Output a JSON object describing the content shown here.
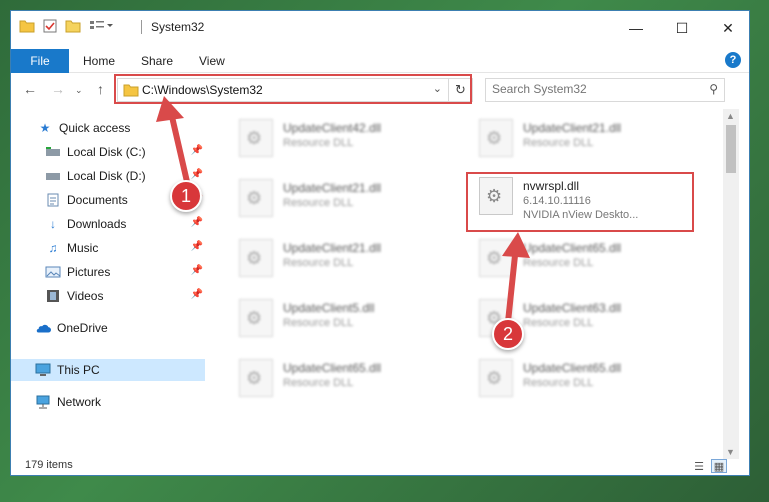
{
  "window": {
    "title": "System32",
    "controls": {
      "minimize": "—",
      "maximize": "☐",
      "close": "✕"
    }
  },
  "ribbon": {
    "tabs": [
      {
        "label": "File"
      },
      {
        "label": "Home"
      },
      {
        "label": "Share"
      },
      {
        "label": "View"
      }
    ],
    "help": "?"
  },
  "navigation": {
    "address_path": "C:\\Windows\\System32",
    "search_placeholder": "Search System32"
  },
  "sidebar": {
    "items": [
      {
        "label": "Quick access",
        "icon": "star-icon",
        "pinned": false
      },
      {
        "label": "Local Disk (C:)",
        "icon": "drive-icon",
        "pinned": true
      },
      {
        "label": "Local Disk (D:)",
        "icon": "drive-icon",
        "pinned": true
      },
      {
        "label": "Documents",
        "icon": "document-icon",
        "pinned": true
      },
      {
        "label": "Downloads",
        "icon": "download-icon",
        "pinned": true
      },
      {
        "label": "Music",
        "icon": "music-icon",
        "pinned": true
      },
      {
        "label": "Pictures",
        "icon": "picture-icon",
        "pinned": true
      },
      {
        "label": "Videos",
        "icon": "video-icon",
        "pinned": true
      },
      {
        "label": "OneDrive",
        "icon": "cloud-icon",
        "pinned": false
      },
      {
        "label": "This PC",
        "icon": "computer-icon",
        "pinned": false,
        "selected": true
      },
      {
        "label": "Network",
        "icon": "network-icon",
        "pinned": false
      }
    ]
  },
  "files": [
    {
      "name": "UpdateClient42.dll",
      "type": "Resource DLL",
      "blurred": true
    },
    {
      "name": "UpdateClient21.dll",
      "type": "Resource DLL",
      "blurred": true
    },
    {
      "name": "UpdateClient21.dll",
      "type": "Resource DLL",
      "blurred": true
    },
    {
      "name": "nvwrspl.dll",
      "version": "6.14.10.11116",
      "description": "NVIDIA nView Deskto...",
      "blurred": false
    },
    {
      "name": "UpdateClient21.dll",
      "type": "Resource DLL",
      "blurred": true
    },
    {
      "name": "UpdateClient65.dll",
      "type": "Resource DLL",
      "blurred": true
    },
    {
      "name": "UpdateClient5.dll",
      "type": "Resource DLL",
      "blurred": true
    },
    {
      "name": "UpdateClient63.dll",
      "type": "Resource DLL",
      "blurred": true
    },
    {
      "name": "UpdateClient65.dll",
      "type": "Resource DLL",
      "blurred": true
    },
    {
      "name": "UpdateClient65.dll",
      "type": "Resource DLL",
      "blurred": true
    }
  ],
  "status": {
    "item_count": "179 items"
  },
  "annotations": {
    "step1": "1",
    "step2": "2",
    "color": "#d94a4a"
  }
}
